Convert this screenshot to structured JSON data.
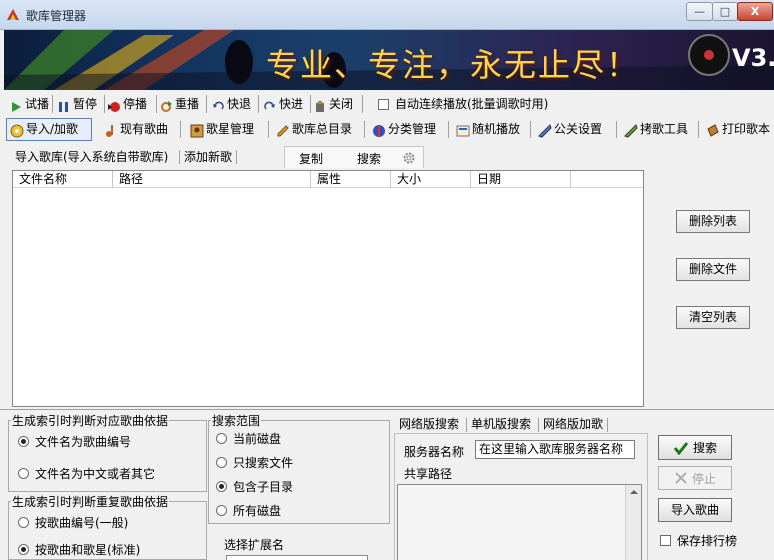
{
  "window": {
    "title": "歌库管理器",
    "controls": {
      "minimize": "—",
      "maximize": "□",
      "close": "X"
    }
  },
  "banner": {
    "slogan": "专业、专注，永无止尽！",
    "version": "V3."
  },
  "toolbar1": {
    "play": "试播",
    "pause": "暂停",
    "stop": "停播",
    "replay": "重播",
    "rewind": "快退",
    "forward": "快进",
    "close": "关闭",
    "auto_play_label": "自动连续播放(批量调歌时用)"
  },
  "toolbar2": {
    "import": "导入/加歌",
    "existing_songs": "现有歌曲",
    "singer_manage": "歌星管理",
    "song_catalog": "歌库总目录",
    "category_manage": "分类管理",
    "random_play": "随机播放",
    "public_settings": "公关设置",
    "copy_tool": "拷歌工具",
    "print_songbook": "打印歌本"
  },
  "tabs": {
    "import_library": "导入歌库(导入系统自带歌库)",
    "add_new": "添加新歌",
    "copy": "复制",
    "search": "搜索"
  },
  "file_list": {
    "columns": [
      "文件名称",
      "路径",
      "属性",
      "大小",
      "日期"
    ]
  },
  "side_buttons": {
    "delete_list": "删除列表",
    "delete_file": "删除文件",
    "clear_list": "清空列表"
  },
  "index_group": {
    "legend": "生成索引时判断对应歌曲依据",
    "option_number": "文件名为歌曲编号",
    "option_chinese": "文件名为中文或者其它"
  },
  "dup_group": {
    "legend": "生成索引时判断重复歌曲依据",
    "option_by_number": "按歌曲编号(一般)",
    "option_by_song_singer": "按歌曲和歌星(标准)"
  },
  "search_scope": {
    "legend": "搜索范围",
    "current_disk": "当前磁盘",
    "only_files": "只搜索文件",
    "include_subdir": "包含子目录",
    "all_disks": "所有磁盘",
    "ext_label": "选择扩展名"
  },
  "network": {
    "tab_net_search": "网络版搜索",
    "tab_single_search": "单机版搜索",
    "tab_net_add": "网络版加歌",
    "server_name_label": "服务器名称",
    "server_name_value": "在这里输入歌库服务器名称",
    "share_path_label": "共享路径"
  },
  "actions": {
    "search": "搜索",
    "stop": "停止",
    "import_songs": "导入歌曲",
    "save_ranking": "保存排行榜"
  }
}
